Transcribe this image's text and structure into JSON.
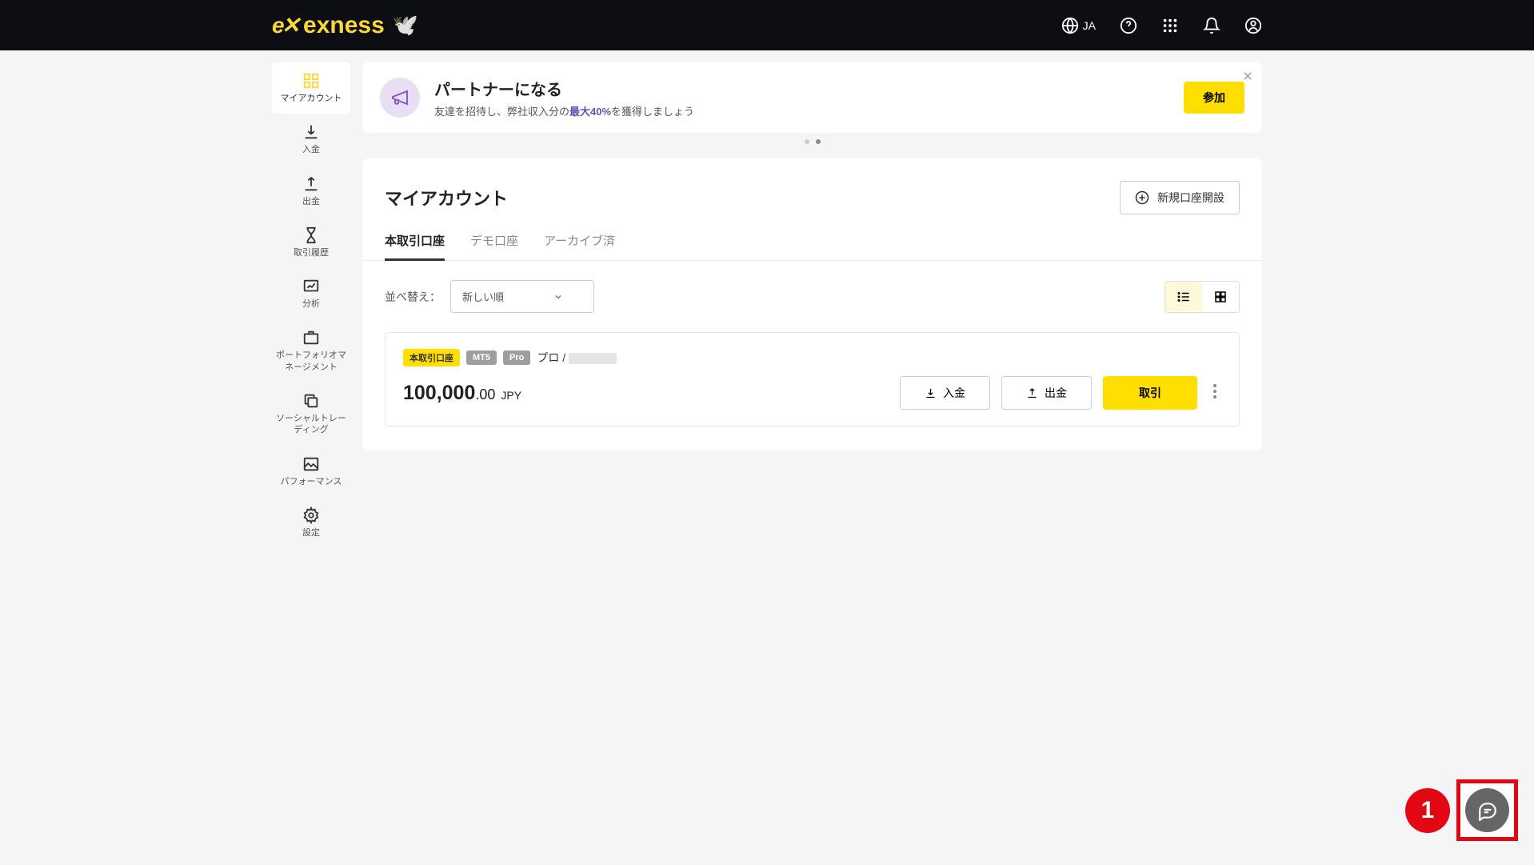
{
  "header": {
    "brand": "exness",
    "lang": "JA"
  },
  "sidebar": {
    "items": [
      {
        "label": "マイアカウント"
      },
      {
        "label": "入金"
      },
      {
        "label": "出金"
      },
      {
        "label": "取引履歴"
      },
      {
        "label": "分析"
      },
      {
        "label": "ポートフォリオマネージメント"
      },
      {
        "label": "ソーシャルトレーディング"
      },
      {
        "label": "パフォーマンス"
      },
      {
        "label": "設定"
      }
    ]
  },
  "banner": {
    "title": "パートナーになる",
    "desc_before": "友達を招待し、弊社収入分の",
    "highlight": "最大40%",
    "desc_after": "を獲得しましょう",
    "cta": "参加"
  },
  "panel": {
    "title": "マイアカウント",
    "new_account": "新規口座開設",
    "tabs": [
      {
        "label": "本取引口座"
      },
      {
        "label": "デモ口座"
      },
      {
        "label": "アーカイブ済"
      }
    ],
    "sort_label": "並べ替え：",
    "sort_value": "新しい順"
  },
  "account": {
    "badges": {
      "real": "本取引口座",
      "platform": "MT5",
      "type": "Pro"
    },
    "name_prefix": "プロ / ",
    "balance_main": "100,000",
    "balance_decimal": ".00",
    "currency": "JPY",
    "deposit": "入金",
    "withdraw": "出金",
    "trade": "取引"
  },
  "annotation": {
    "step": "1"
  }
}
